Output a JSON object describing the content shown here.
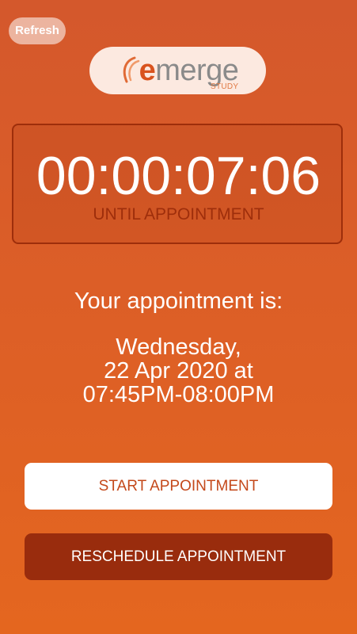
{
  "header": {
    "refresh_label": "Refresh"
  },
  "logo": {
    "brand": "merge",
    "brand_initial": "e",
    "sub": "STUDY",
    "brand_color": "#d9531e"
  },
  "countdown": {
    "value": "00:00:07:06",
    "label": "UNTIL APPOINTMENT"
  },
  "appointment": {
    "heading": "Your appointment is:",
    "day": "Wednesday,",
    "date": "22 Apr 2020 at",
    "time": "07:45PM-08:00PM"
  },
  "actions": {
    "start_label": "START APPOINTMENT",
    "reschedule_label": "RESCHEDULE APPOINTMENT"
  },
  "colors": {
    "background": "#dc5e27",
    "accent_dark": "#992c0d",
    "start_text": "#c4491b"
  }
}
